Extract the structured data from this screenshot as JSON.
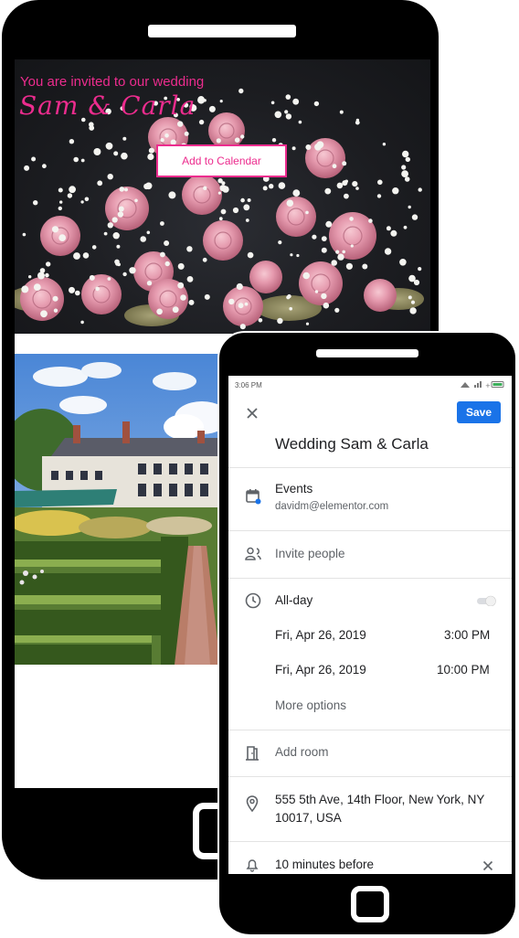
{
  "invitation": {
    "invite_line": "You are invited to our wedding",
    "couple_names": "Sam & Carla",
    "add_calendar_label": "Add to Calendar"
  },
  "calendar": {
    "status_time": "3:06 PM",
    "save_label": "Save",
    "title": "Wedding Sam & Carla",
    "calendar_name": "Events",
    "account": "davidm@elementor.com",
    "invite_people": "Invite people",
    "all_day_label": "All-day",
    "all_day_on": false,
    "start_date": "Fri, Apr 26, 2019",
    "start_time": "3:00 PM",
    "end_date": "Fri, Apr 26, 2019",
    "end_time": "10:00 PM",
    "more_options": "More options",
    "add_room": "Add room",
    "location_line1": "555 5th Ave, 14th Floor, New York, NY",
    "location_line2": "10017, USA",
    "notification": "10 minutes before"
  },
  "colors": {
    "accent_pink": "#ec2c8e",
    "save_blue": "#1a73e8",
    "calendar_dot": "#1a73e8"
  }
}
